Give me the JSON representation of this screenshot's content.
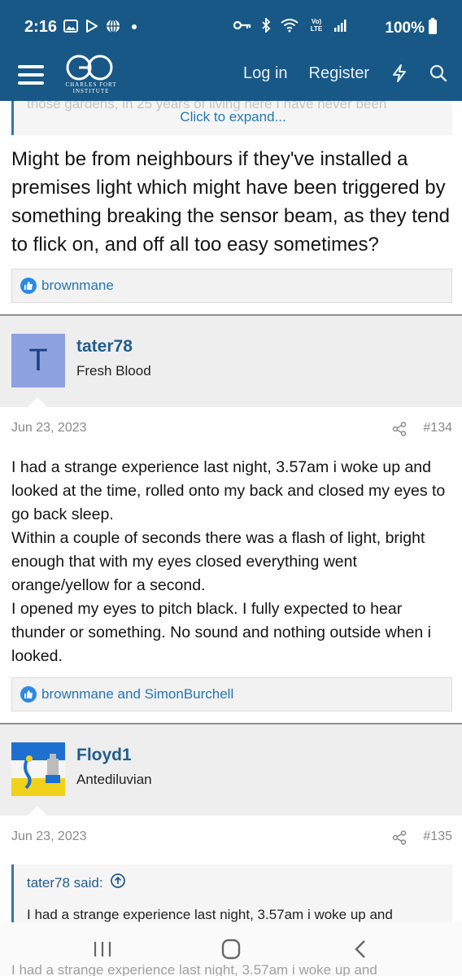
{
  "status_bar": {
    "time": "2:16",
    "battery": "100%",
    "left_icons": [
      "image-icon",
      "play-store-icon",
      "globe-icon",
      "dot-icon"
    ],
    "right_icons": [
      "key-icon",
      "bluetooth-icon",
      "wifi-icon",
      "volte-icon",
      "signal-icon",
      "battery-icon"
    ],
    "volte": "Vo) LTE"
  },
  "header": {
    "logo_initials": "CF",
    "logo_line1": "CHARLES FORT",
    "logo_line2": "INSTITUTE",
    "login": "Log in",
    "register": "Register"
  },
  "posts": [
    {
      "quote_tail": "those gardens, in 25 years of living here I have never been",
      "expand": "Click to expand...",
      "body": "Might be from neighbours if they've installed a premises light which might have been triggered by something breaking the sensor beam, as they tend to flick on, and off all too easy sometimes?",
      "reactions": "brownmane"
    },
    {
      "author": "tater78",
      "avatar_letter": "T",
      "rank": "Fresh Blood",
      "date": "Jun 23, 2023",
      "number": "#134",
      "body": "I had a strange experience last night, 3.57am i woke up and looked at the time, rolled onto my back and closed my eyes to go back sleep.\nWithin a couple of seconds there was a flash of light, bright enough that with my eyes closed everything went orange/yellow for a second.\nI opened my eyes to pitch black. I fully expected to hear thunder or something. No sound and nothing outside when i looked.",
      "reactions": "brownmane and SimonBurchell"
    },
    {
      "author": "Floyd1",
      "rank": "Antediluvian",
      "date": "Jun 23, 2023",
      "number": "#135",
      "quote_author": "tater78 said:",
      "quote_text": "I had a strange experience last night, 3.57am i woke up and",
      "bleed_text": "I had a strange experience last night, 3.57am i woke up and"
    }
  ],
  "colors": {
    "header_bg": "#185886",
    "link": "#2577b1",
    "author": "#225d8f",
    "like": "#2b8ae6"
  }
}
